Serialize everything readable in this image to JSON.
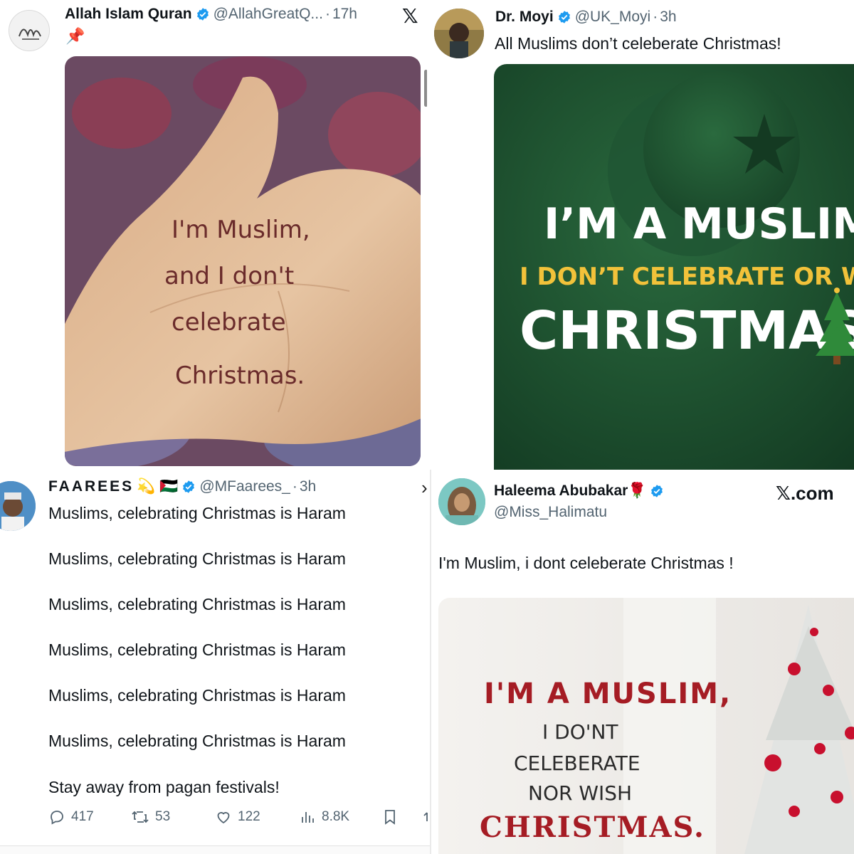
{
  "tweets": {
    "t1": {
      "name": "Allah Islam Quran",
      "handle": "@AllahGreatQ...",
      "time": "17h",
      "pin_emoji": "📌",
      "x_logo": "𝕏",
      "image_text": [
        "I'm Muslim,",
        "and I don't",
        "celebrate",
        "Christmas."
      ]
    },
    "t2": {
      "name": "Dr. Moyi",
      "handle": "@UK_Moyi",
      "time": "3h",
      "text": "All Muslims don’t celeberate Christmas!",
      "image_text": {
        "line1": "I’M A MUSLIM -",
        "line2": "I DON’T CELEBRATE OR WIS",
        "line3": "CHRISTMAS"
      }
    },
    "t3": {
      "name": "FAAREES",
      "name_emojis": "💫 🇵🇸",
      "handle": "@MFaarees_",
      "time": "3h",
      "lines": [
        "Muslims, celebrating Christmas is Haram",
        "Muslims, celebrating Christmas is Haram",
        "Muslims, celebrating Christmas is Haram",
        "Muslims, celebrating Christmas is Haram",
        "Muslims, celebrating Christmas is Haram",
        "Muslims, celebrating Christmas is Haram",
        "Stay away from pagan festivals!"
      ],
      "actions": {
        "replies": "417",
        "reposts": "53",
        "likes": "122",
        "views": "8.8K"
      },
      "more_chevron": "›"
    },
    "t4": {
      "name": "Haleema Abubakar",
      "name_emoji": "🌹",
      "handle": "@Miss_Halimatu",
      "site": "𝕏.com",
      "text": "I'm Muslim, i dont celeberate Christmas !",
      "image_text": {
        "line1": "I'M A MUSLIM,",
        "line2": "I DO'NT",
        "line3": "CELEBERATE",
        "line4": "NOR WISH",
        "line5": "CHRISTMAS."
      }
    }
  },
  "colors": {
    "verified_blue": "#1d9bf0",
    "text_primary": "#0f1419",
    "text_secondary": "#536471",
    "green_bg": "#1d4a2c",
    "gold_text": "#f2c23a",
    "red_text": "#a51c24"
  }
}
